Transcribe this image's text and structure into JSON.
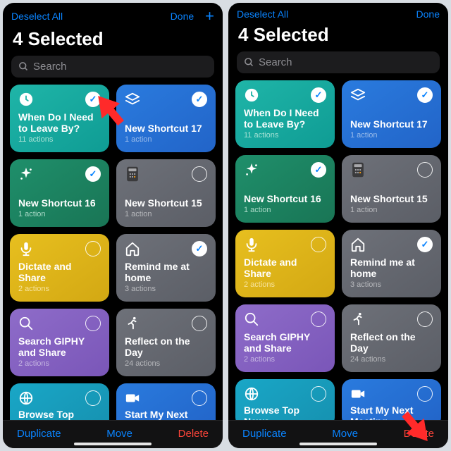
{
  "header": {
    "deselect": "Deselect All",
    "done": "Done",
    "title": "4 Selected"
  },
  "search": {
    "placeholder": "Search"
  },
  "shortcuts": [
    {
      "name": "When Do I Need to Leave By?",
      "sub": "11 actions",
      "icon": "clock",
      "color": "teal",
      "selected": true
    },
    {
      "name": "New Shortcut 17",
      "sub": "1 action",
      "icon": "stack",
      "color": "blue",
      "selected": true
    },
    {
      "name": "New Shortcut 16",
      "sub": "1 action",
      "icon": "sparkle",
      "color": "green",
      "selected": true
    },
    {
      "name": "New Shortcut 15",
      "sub": "1 action",
      "icon": "calculator",
      "color": "grey",
      "selected": false
    },
    {
      "name": "Dictate and Share",
      "sub": "2 actions",
      "icon": "mic",
      "color": "yellow",
      "selected": false
    },
    {
      "name": "Remind me at home",
      "sub": "3 actions",
      "icon": "home",
      "color": "grey",
      "selected": true
    },
    {
      "name": "Search GIPHY and Share",
      "sub": "2 actions",
      "icon": "search",
      "color": "purple",
      "selected": false
    },
    {
      "name": "Reflect on the Day",
      "sub": "24 actions",
      "icon": "runner",
      "color": "grey",
      "selected": false
    },
    {
      "name": "Browse Top News",
      "sub": "",
      "icon": "globe",
      "color": "cyan",
      "selected": false
    },
    {
      "name": "Start My Next Meeting",
      "sub": "",
      "icon": "video",
      "color": "blue",
      "selected": false
    }
  ],
  "toolbar": {
    "duplicate": "Duplicate",
    "move": "Move",
    "delete": "Delete"
  }
}
